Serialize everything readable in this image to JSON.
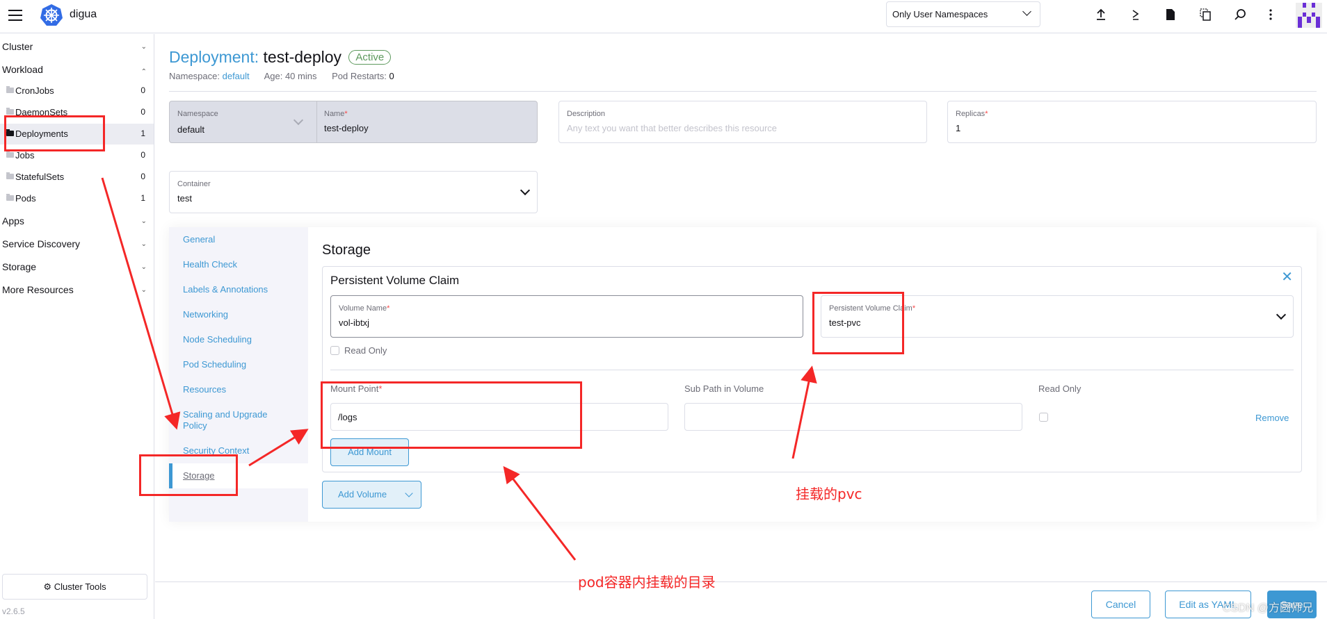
{
  "header": {
    "cluster_name": "digua",
    "namespace_filter": "Only User Namespaces",
    "icons": [
      "import-yaml-icon",
      "kubectl-shell-icon",
      "kubeconfig-download-icon",
      "copy-kubeconfig-icon",
      "search-icon",
      "more-menu-icon"
    ]
  },
  "sidebar": {
    "groups": [
      {
        "label": "Cluster",
        "expanded": false
      },
      {
        "label": "Workload",
        "expanded": true
      },
      {
        "label": "Apps",
        "expanded": false
      },
      {
        "label": "Service Discovery",
        "expanded": false
      },
      {
        "label": "Storage",
        "expanded": false
      },
      {
        "label": "More Resources",
        "expanded": false
      }
    ],
    "workload_items": [
      {
        "label": "CronJobs",
        "count": "0"
      },
      {
        "label": "DaemonSets",
        "count": "0"
      },
      {
        "label": "Deployments",
        "count": "1",
        "active": true
      },
      {
        "label": "Jobs",
        "count": "0"
      },
      {
        "label": "StatefulSets",
        "count": "0"
      },
      {
        "label": "Pods",
        "count": "1"
      }
    ],
    "cluster_tools": "Cluster Tools",
    "version": "v2.6.5"
  },
  "page": {
    "kind": "Deployment:",
    "name": "test-deploy",
    "state": "Active",
    "meta": {
      "namespace_label": "Namespace:",
      "namespace": "default",
      "age_label": "Age:",
      "age": "40 mins",
      "restarts_label": "Pod Restarts:",
      "restarts": "0"
    }
  },
  "form": {
    "namespace": {
      "label": "Namespace",
      "value": "default"
    },
    "name": {
      "label": "Name",
      "required": "*",
      "value": "test-deploy"
    },
    "description": {
      "label": "Description",
      "placeholder": "Any text you want that better describes this resource"
    },
    "replicas": {
      "label": "Replicas",
      "required": "*",
      "value": "1"
    },
    "container": {
      "label": "Container",
      "value": "test"
    }
  },
  "tabs": [
    "General",
    "Health Check",
    "Labels & Annotations",
    "Networking",
    "Node Scheduling",
    "Pod Scheduling",
    "Resources",
    "Scaling and Upgrade Policy",
    "Security Context",
    "Storage"
  ],
  "active_tab": "Storage",
  "storage": {
    "title": "Storage",
    "card_title": "Persistent Volume Claim",
    "volume_name": {
      "label": "Volume Name",
      "required": "*",
      "value": "vol-ibtxj"
    },
    "pvc": {
      "label": "Persistent Volume Claim",
      "required": "*",
      "value": "test-pvc"
    },
    "read_only_label": "Read Only",
    "read_only_checked": false,
    "mount_point": {
      "label": "Mount Point",
      "required": "*",
      "value": "/logs"
    },
    "sub_path": {
      "label": "Sub Path in Volume",
      "value": ""
    },
    "mount_read_only_label": "Read Only",
    "mount_read_only_checked": false,
    "remove": "Remove",
    "add_mount": "Add Mount",
    "add_volume": "Add Volume"
  },
  "footer": {
    "cancel": "Cancel",
    "edit_yaml": "Edit as YAML",
    "save": "Save"
  },
  "annotations": {
    "pvc_note": "挂载的pvc",
    "mount_note": "pod容器内挂载的目录",
    "watermark": "CSDN @方圆师兄",
    "color": "#f42727"
  },
  "colors": {
    "accent": "#3d98d3",
    "active_green": "#5d995d",
    "required_red": "#f64747"
  }
}
